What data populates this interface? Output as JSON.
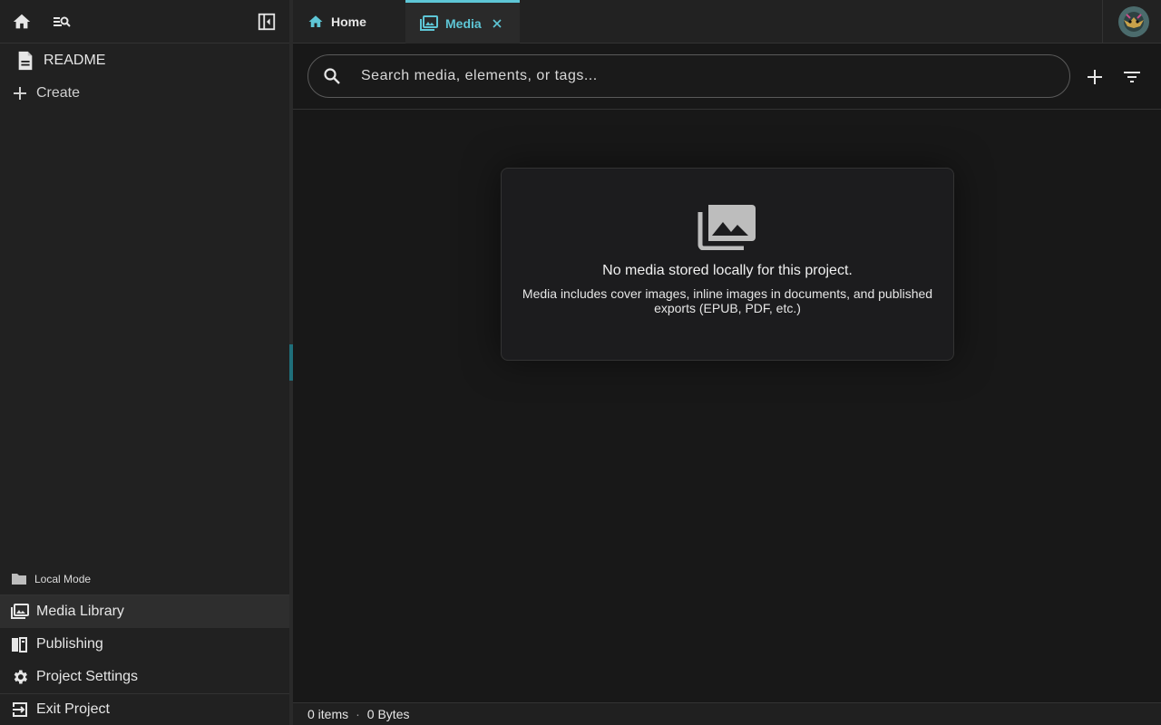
{
  "sidebar": {
    "top_icons": [
      "home-icon",
      "search-list-icon",
      "collapse-sidebar-icon"
    ],
    "readme_label": "README",
    "create_label": "Create",
    "mode_label": "Local Mode",
    "nav": {
      "media_library": "Media Library",
      "publishing": "Publishing",
      "project_settings": "Project Settings",
      "exit_project": "Exit Project"
    }
  },
  "tabs": {
    "home": "Home",
    "media": "Media",
    "active": "Media"
  },
  "search": {
    "placeholder": "Search media, elements, or tags...",
    "value": ""
  },
  "empty_state": {
    "title": "No media stored locally for this project.",
    "description": "Media includes cover images, inline images in documents, and published exports (EPUB, PDF, etc.)"
  },
  "status": {
    "items": "0 items",
    "separator": "·",
    "size": "0 Bytes"
  },
  "colors": {
    "accent": "#5ec6d6",
    "background": "#181818",
    "sidebar": "#212121"
  }
}
